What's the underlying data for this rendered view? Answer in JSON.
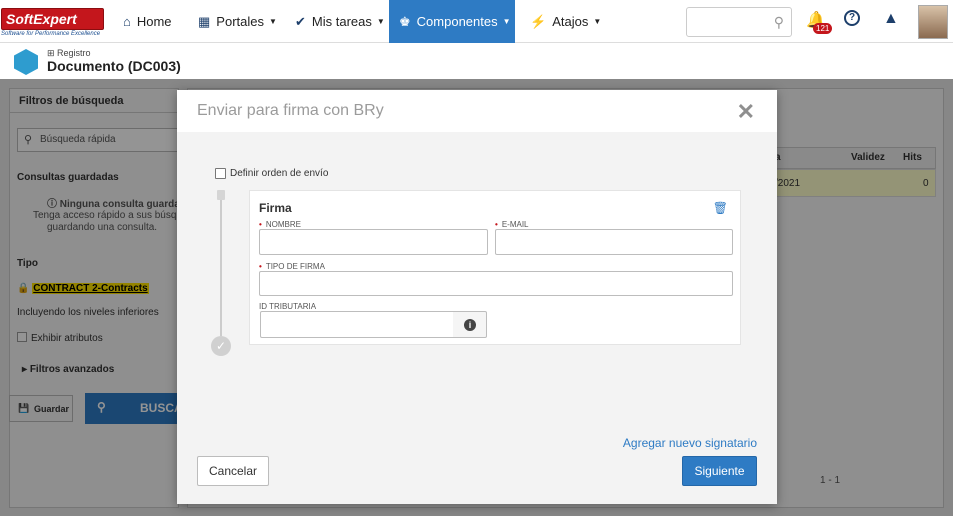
{
  "brand": {
    "name": "SoftExpert",
    "tagline": "Software for Performance Excellence",
    "color": "#c4161c"
  },
  "nav": {
    "items": [
      {
        "label": "Home",
        "icon": "home-icon"
      },
      {
        "label": "Portales",
        "icon": "grid-icon"
      },
      {
        "label": "Mis tareas",
        "icon": "check-icon"
      },
      {
        "label": "Componentes",
        "icon": "trophy-icon",
        "active": true
      },
      {
        "label": "Atajos",
        "icon": "bolt-icon"
      }
    ],
    "notifications_count": "121",
    "accent": "#2e7bc4"
  },
  "page": {
    "breadcrumb": "Registro",
    "title": "Documento (DC003)"
  },
  "left_panel": {
    "header": "Filtros de búsqueda",
    "quick_search_placeholder": "Búsqueda rápida",
    "saved_queries_title": "Consultas guardadas",
    "no_saved_query": "Ninguna consulta guardada",
    "saved_hint_1": "Tenga acceso rápido a sus búsque",
    "saved_hint_2": "guardando una consulta.",
    "type_title": "Tipo",
    "type_value": "CONTRACT 2-Contracts",
    "include_lower": "Incluyendo los niveles inferiores",
    "show_attributes": "Exhibir atributos",
    "advanced_filters": "Filtros avanzados",
    "save_button": "Guardar",
    "search_button": "BUSCA"
  },
  "grid": {
    "col_partial": "a",
    "col_validez": "Validez",
    "col_hits": "Hits",
    "row_date_partial": "/2021",
    "row_hits": "0",
    "pager": "1 - 1"
  },
  "modal": {
    "title": "Enviar para firma con BRy",
    "order_checkbox": "Definir orden de envío",
    "card_title": "Firma",
    "fields": {
      "name_label": "NOMBRE",
      "email_label": "E-MAIL",
      "signature_type_label": "TIPO DE FIRMA",
      "tax_id_label": "ID TRIBUTARIA"
    },
    "add_signer": "Agregar nuevo signatario",
    "cancel": "Cancelar",
    "next": "Siguiente"
  }
}
